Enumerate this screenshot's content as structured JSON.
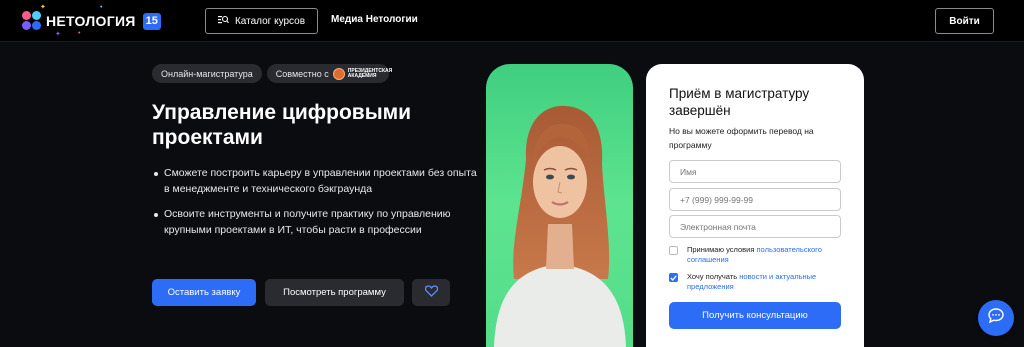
{
  "header": {
    "brand": "НЕТОЛОГИЯ",
    "badge": "15",
    "catalog_label": "Каталог курсов",
    "media_label": "Медиа Нетологии",
    "login_label": "Войти"
  },
  "hero": {
    "chip_format": "Онлайн-магистратура",
    "chip_partner": "Совместно с",
    "partner_logo_text": "Президентская академия",
    "title": "Управление цифровыми проектами",
    "bullets": [
      "Сможете построить карьеру в управлении проектами без опыта в менеджменте и технического бэкграунда",
      "Освоите инструменты и получите практику по управлению крупными проектами в ИТ, чтобы расти в профессии"
    ],
    "apply_label": "Оставить заявку",
    "program_label": "Посмотреть программу"
  },
  "form": {
    "title": "Приём в магистратуру завершён",
    "subtitle": "Но вы можете оформить перевод на программу",
    "name_placeholder": "Имя",
    "phone_placeholder": "+7 (999) 999-99-99",
    "email_placeholder": "Электронная почта",
    "consent_text": "Принимаю условия ",
    "consent_link": "пользовательского соглашения",
    "news_text": "Хочу получать ",
    "news_link": "новости и актуальные предложения",
    "consent_checked": false,
    "news_checked": true,
    "submit_label": "Получить консультацию"
  },
  "colors": {
    "accent": "#2d6cf6",
    "background": "#0b0c10",
    "photo_bg": "#5ee48f"
  },
  "icons": {
    "catalog": "catalog-search-icon",
    "favorite": "heart-icon",
    "chat": "chat-bubble-icon"
  }
}
